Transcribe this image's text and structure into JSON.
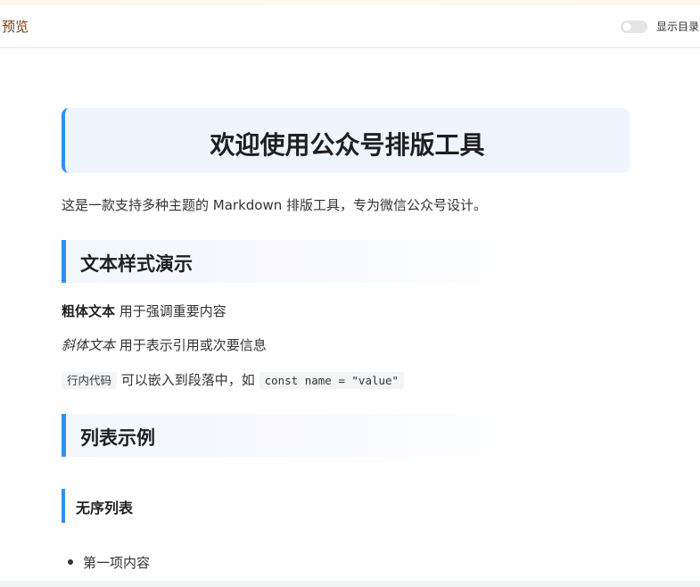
{
  "header": {
    "title": "预览",
    "toc_toggle_label": "显示目录",
    "toc_toggle_on": false
  },
  "article": {
    "h1": "欢迎使用公众号排版工具",
    "intro": "这是一款支持多种主题的 Markdown 排版工具，专为微信公众号设计。",
    "section1": {
      "heading": "文本样式演示",
      "bold_text": "粗体文本",
      "bold_rest": " 用于强调重要内容",
      "italic_text": "斜体文本",
      "italic_rest": " 用于表示引用或次要信息",
      "code_inline": "行内代码",
      "code_middle": " 可以嵌入到段落中，如 ",
      "code_sample": "const name = \"value\""
    },
    "section2": {
      "heading": "列表示例",
      "subheading": "无序列表",
      "items": [
        "第一项内容"
      ]
    }
  },
  "colors": {
    "accent": "#2f8ff0",
    "h1_bg": "#eef5fe",
    "header_title": "#7a3c12"
  }
}
